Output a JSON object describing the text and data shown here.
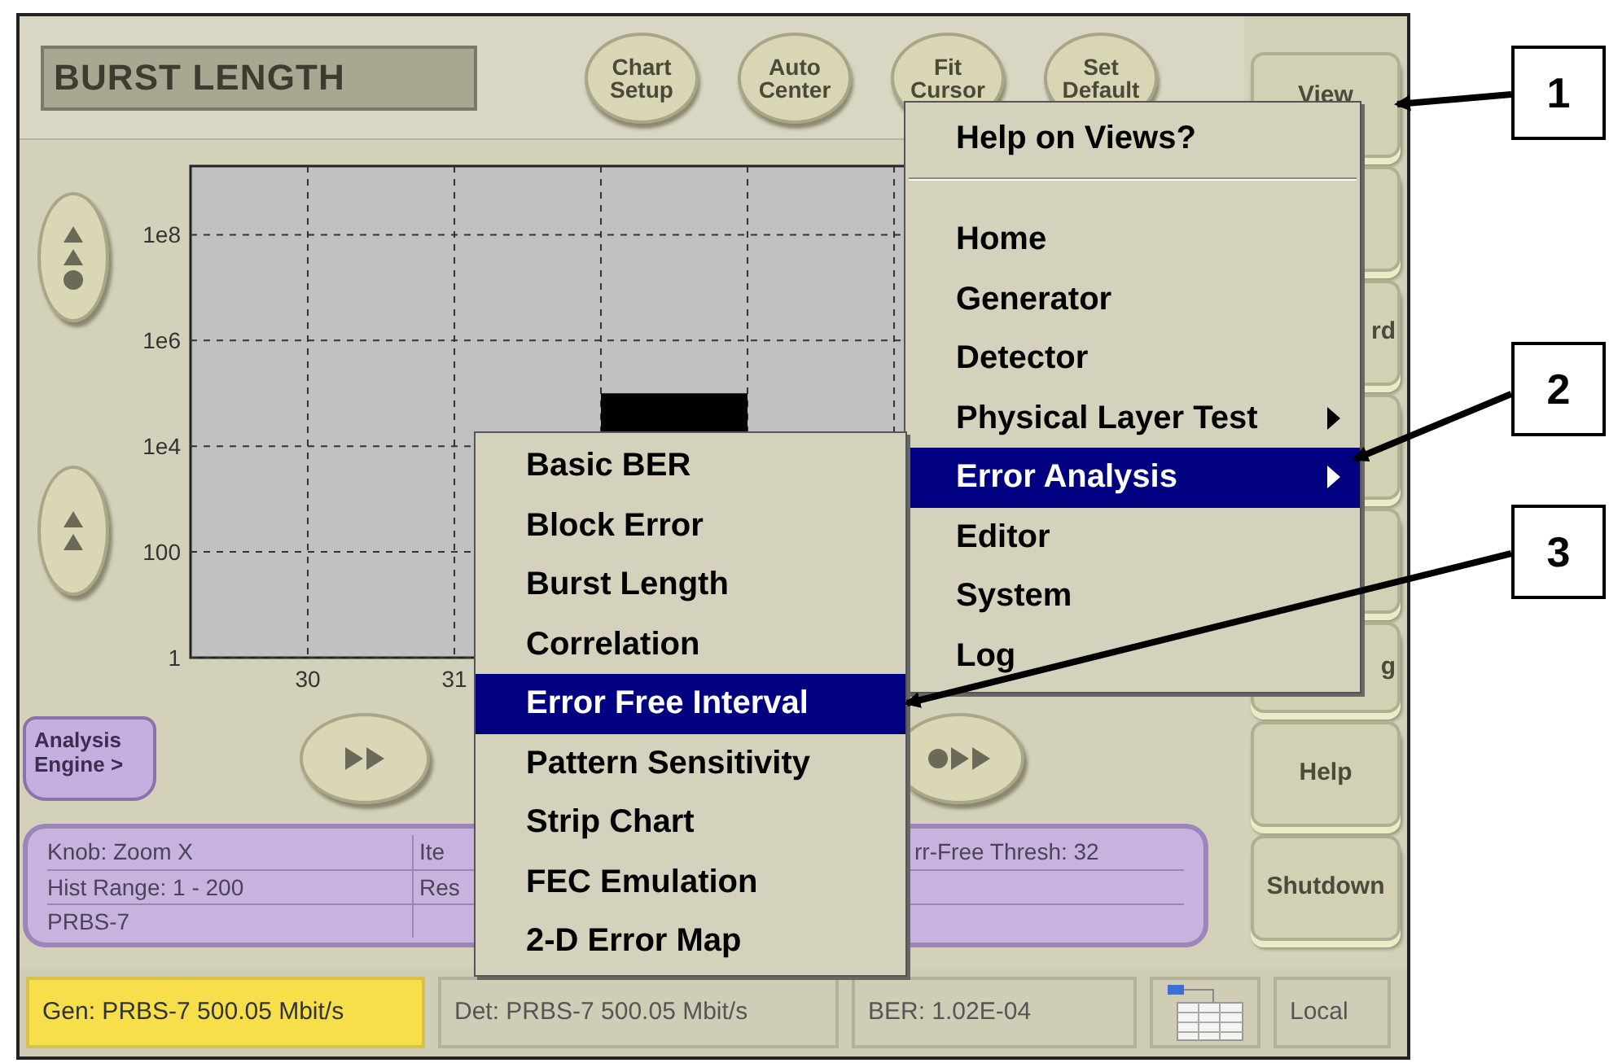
{
  "title_display": "BURST LENGTH",
  "round_buttons": [
    {
      "label": "Chart\nSetup"
    },
    {
      "label": "Auto\nCenter"
    },
    {
      "label": "Fit\nCursor"
    },
    {
      "label": "Set\nDefault"
    }
  ],
  "side_buttons": [
    {
      "kind": "labelled",
      "label": "View"
    },
    {
      "kind": "blank"
    },
    {
      "kind": "labelled",
      "label": "rd"
    },
    {
      "kind": "blank"
    },
    {
      "kind": "blank"
    },
    {
      "kind": "labelled",
      "label": "g"
    },
    {
      "kind": "labelled",
      "label": "Help"
    },
    {
      "kind": "labelled",
      "label": "Shutdown"
    }
  ],
  "scale_buttons": [
    {
      "kind": "up-up-dot"
    },
    {
      "kind": "up-up"
    }
  ],
  "histogram": {
    "y_axis_labels": [
      "1e8",
      "1e6",
      "1e4",
      "100",
      "1"
    ],
    "x_axis_labels": [
      "30",
      "31"
    ]
  },
  "analysis_engine_button": "Analysis\nEngine >",
  "scroll_buttons": [
    {
      "kind": "forward"
    },
    {
      "kind": "dot-forward"
    }
  ],
  "info_panel": {
    "rows": [
      [
        "Knob:  Zoom X",
        "Ite",
        "rr-Free Thresh: 32"
      ],
      [
        "Hist Range: 1 - 200",
        "Res",
        ""
      ],
      [
        "PRBS-7",
        "",
        ""
      ]
    ]
  },
  "status_bar": [
    {
      "kind": "text",
      "text": "Gen: PRBS-7  500.05 Mbit/s",
      "highlighted": true
    },
    {
      "kind": "text",
      "text": "Det: PRBS-7  500.05 Mbit/s",
      "highlighted": false
    },
    {
      "kind": "text",
      "text": "BER: 1.02E-04",
      "highlighted": false
    },
    {
      "kind": "icon"
    },
    {
      "kind": "text",
      "text": "Local",
      "highlighted": false
    }
  ],
  "view_menu": {
    "header": "Help on Views?",
    "items": [
      {
        "label": "Home",
        "selected": false,
        "has_submenu": false
      },
      {
        "label": "Generator",
        "selected": false,
        "has_submenu": false
      },
      {
        "label": "Detector",
        "selected": false,
        "has_submenu": false
      },
      {
        "label": "Physical Layer Test",
        "selected": false,
        "has_submenu": true
      },
      {
        "label": "Error Analysis",
        "selected": true,
        "has_submenu": true
      },
      {
        "label": "Editor",
        "selected": false,
        "has_submenu": false
      },
      {
        "label": "System",
        "selected": false,
        "has_submenu": false
      },
      {
        "label": "Log",
        "selected": false,
        "has_submenu": false
      }
    ]
  },
  "submenu": {
    "items": [
      {
        "label": "Basic BER",
        "selected": false
      },
      {
        "label": "Block Error",
        "selected": false
      },
      {
        "label": "Burst Length",
        "selected": false
      },
      {
        "label": "Correlation",
        "selected": false
      },
      {
        "label": "Error Free Interval",
        "selected": true
      },
      {
        "label": "Pattern Sensitivity",
        "selected": false
      },
      {
        "label": "Strip Chart",
        "selected": false
      },
      {
        "label": "FEC Emulation",
        "selected": false
      },
      {
        "label": "2-D Error Map",
        "selected": false
      }
    ]
  },
  "callouts": [
    "1",
    "2",
    "3"
  ]
}
